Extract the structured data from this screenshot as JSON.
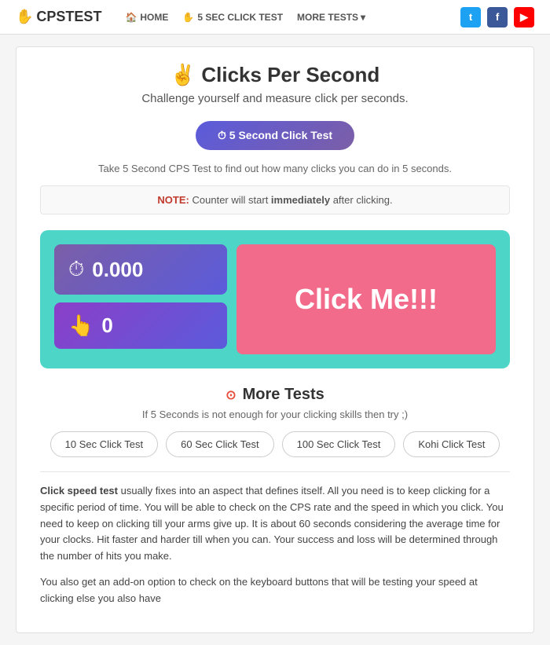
{
  "nav": {
    "logo_icon": "✋",
    "logo_text": "CPSTEST",
    "links": [
      {
        "id": "home",
        "icon": "🏠",
        "label": "HOME"
      },
      {
        "id": "5sec",
        "icon": "✋",
        "label": "5 SEC CLICK TEST"
      },
      {
        "id": "more",
        "label": "MORE TESTS",
        "has_dropdown": true
      }
    ],
    "social": [
      {
        "id": "twitter",
        "icon": "t",
        "bg_class": "twitter-bg"
      },
      {
        "id": "facebook",
        "icon": "f",
        "bg_class": "facebook-bg"
      },
      {
        "id": "youtube",
        "icon": "▶",
        "bg_class": "youtube-bg"
      }
    ]
  },
  "page": {
    "title_icon": "✌️",
    "title": "Clicks Per Second",
    "subtitle": "Challenge yourself and measure click per seconds."
  },
  "cta": {
    "button_icon": "⏱",
    "button_label": "5 Second Click Test",
    "description": "Take 5 Second CPS Test to find out how many clicks you can do in 5 seconds."
  },
  "note": {
    "label": "NOTE:",
    "text": " Counter will start ",
    "emphasis": "immediately",
    "text2": " after clicking."
  },
  "game": {
    "time_value": "0.000",
    "clicks_value": "0",
    "click_button_label": "Click Me!!!"
  },
  "more_tests": {
    "section_icon": "⊙",
    "title": "More Tests",
    "subtitle": "If 5 Seconds is not enough for your clicking skills then try ;)",
    "buttons": [
      "10 Sec Click Test",
      "60 Sec Click Test",
      "100 Sec Click Test",
      "Kohi Click Test"
    ]
  },
  "description": {
    "para1_bold": "Click speed test",
    "para1_rest": " usually fixes into an aspect that defines itself. All you need is to keep clicking for a specific period of time. You will be able to check on the CPS rate and the speed in which you click. You need to keep on clicking till your arms give up. It is about 60 seconds considering the average time for your clocks. Hit faster and harder till when you can. Your success and loss will be determined through the number of hits you make.",
    "para2": "You also get an add-on option to check on the keyboard buttons that will be testing your speed at clicking else you also have"
  }
}
